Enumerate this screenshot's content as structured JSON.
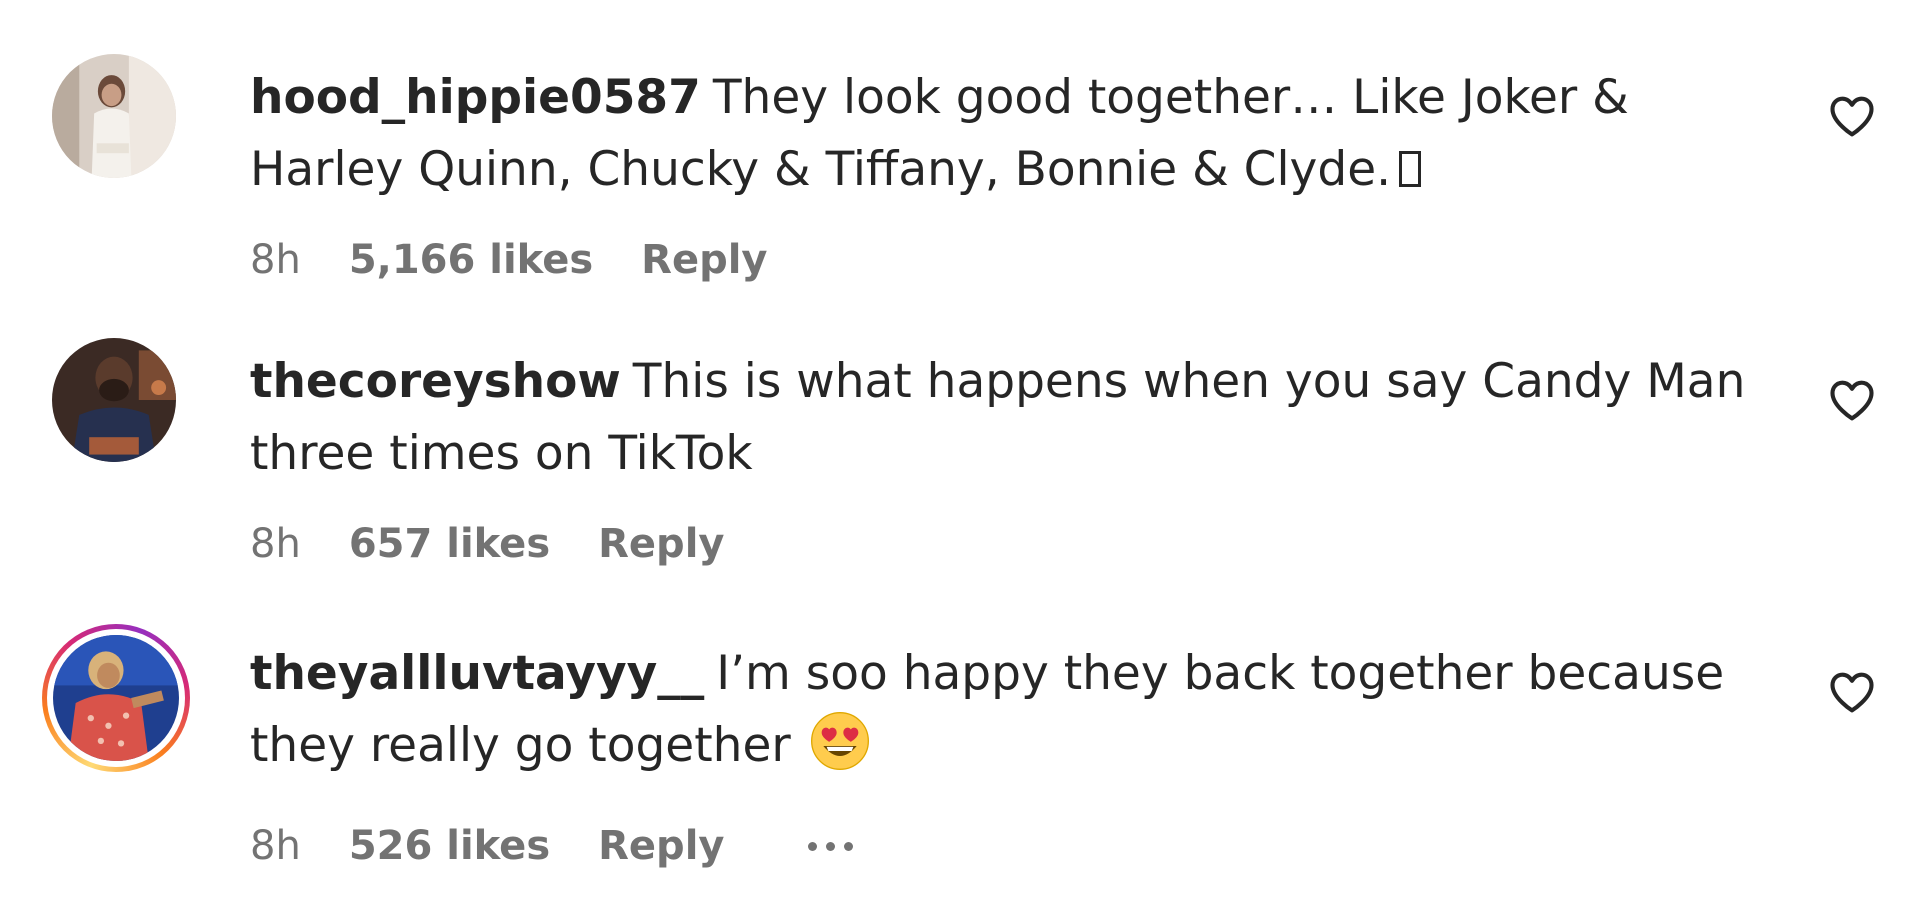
{
  "comments": [
    {
      "username": "hood_hippie0587",
      "text": "They look good together… Like Joker & Harley Quinn, Chucky & Tiffany, Bonnie & Clyde.",
      "time": "8h",
      "likes": "5,166 likes",
      "reply": "Reply",
      "avatar_icon": "avatar-photo",
      "story_ring": false
    },
    {
      "username": "thecoreyshow",
      "text": "This is what happens when you say Candy Man three times on TikTok",
      "time": "8h",
      "likes": "657 likes",
      "reply": "Reply",
      "avatar_icon": "avatar-photo",
      "story_ring": false
    },
    {
      "username": "theyallluvtayyy__",
      "text": "I’m soo happy they back together because they really go together",
      "time": "8h",
      "likes": "526 likes",
      "reply": "Reply",
      "avatar_icon": "avatar-photo",
      "story_ring": true,
      "has_more_options": true
    }
  ],
  "icons": {
    "like": "heart-outline-icon",
    "more": "more-options-icon",
    "emoji": "heart-eyes-emoji"
  },
  "colors": {
    "text": "#262626",
    "secondary": "#737373",
    "story_ring": [
      "#feda75",
      "#fa7e1e",
      "#d62976",
      "#962fbf"
    ]
  }
}
